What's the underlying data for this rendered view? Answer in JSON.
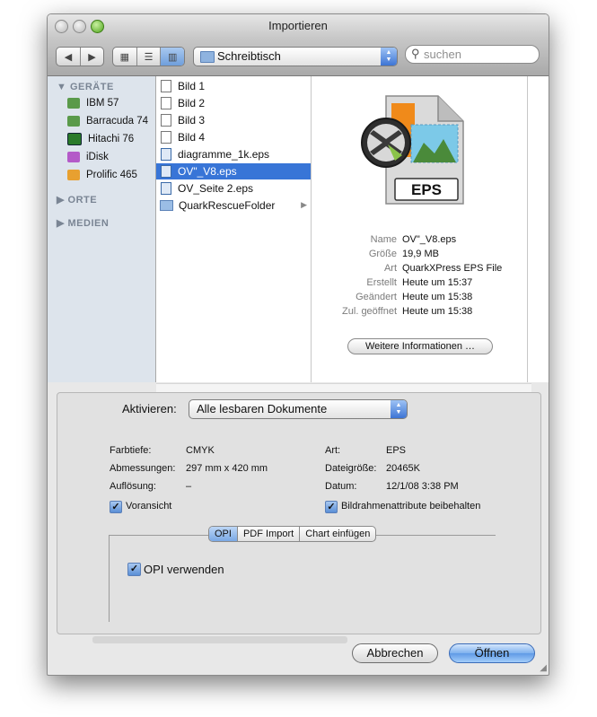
{
  "window": {
    "title": "Importieren"
  },
  "toolbar": {
    "location": "Schreibtisch",
    "search_placeholder": "suchen"
  },
  "sidebar": {
    "devices_header": "GERÄTE",
    "devices": [
      "IBM 57",
      "Barracuda 74",
      "Hitachi 76",
      "iDisk",
      "Prolific 465"
    ],
    "places_header": "ORTE",
    "media_header": "MEDIEN"
  },
  "files": [
    "Bild 1",
    "Bild 2",
    "Bild 3",
    "Bild 4",
    "diagramme_1k.eps",
    "OV\"_V8.eps",
    "OV_Seite 2.eps",
    "QuarkRescueFolder"
  ],
  "preview": {
    "badge": "EPS",
    "meta": [
      {
        "key": "Name",
        "value": "OV\"_V8.eps"
      },
      {
        "key": "Größe",
        "value": "19,9 MB"
      },
      {
        "key": "Art",
        "value": "QuarkXPress EPS File"
      },
      {
        "key": "Erstellt",
        "value": "Heute um 15:37"
      },
      {
        "key": "Geändert",
        "value": "Heute um 15:38"
      },
      {
        "key": "Zul. geöffnet",
        "value": "Heute um 15:38"
      }
    ],
    "more_button": "Weitere Informationen …"
  },
  "options": {
    "enable_label": "Aktivieren:",
    "enable_value": "Alle lesbaren Dokumente",
    "farbtiefe_label": "Farbtiefe:",
    "farbtiefe_value": "CMYK",
    "abmessungen_label": "Abmessungen:",
    "abmessungen_value": "297 mm x 420 mm",
    "aufloesung_label": "Auflösung:",
    "aufloesung_value": "–",
    "art_label": "Art:",
    "art_value": "EPS",
    "dateigroesse_label": "Dateigröße:",
    "dateigroesse_value": "20465K",
    "datum_label": "Datum:",
    "datum_value": "12/1/08 3:38 PM",
    "vorschau_label": "Voransicht",
    "bildrahmen_label": "Bildrahmenattribute beibehalten",
    "tabs": [
      "OPI",
      "PDF Import",
      "Chart einfügen"
    ],
    "opi_label": "OPI verwenden"
  },
  "buttons": {
    "cancel": "Abbrechen",
    "open": "Öffnen"
  }
}
